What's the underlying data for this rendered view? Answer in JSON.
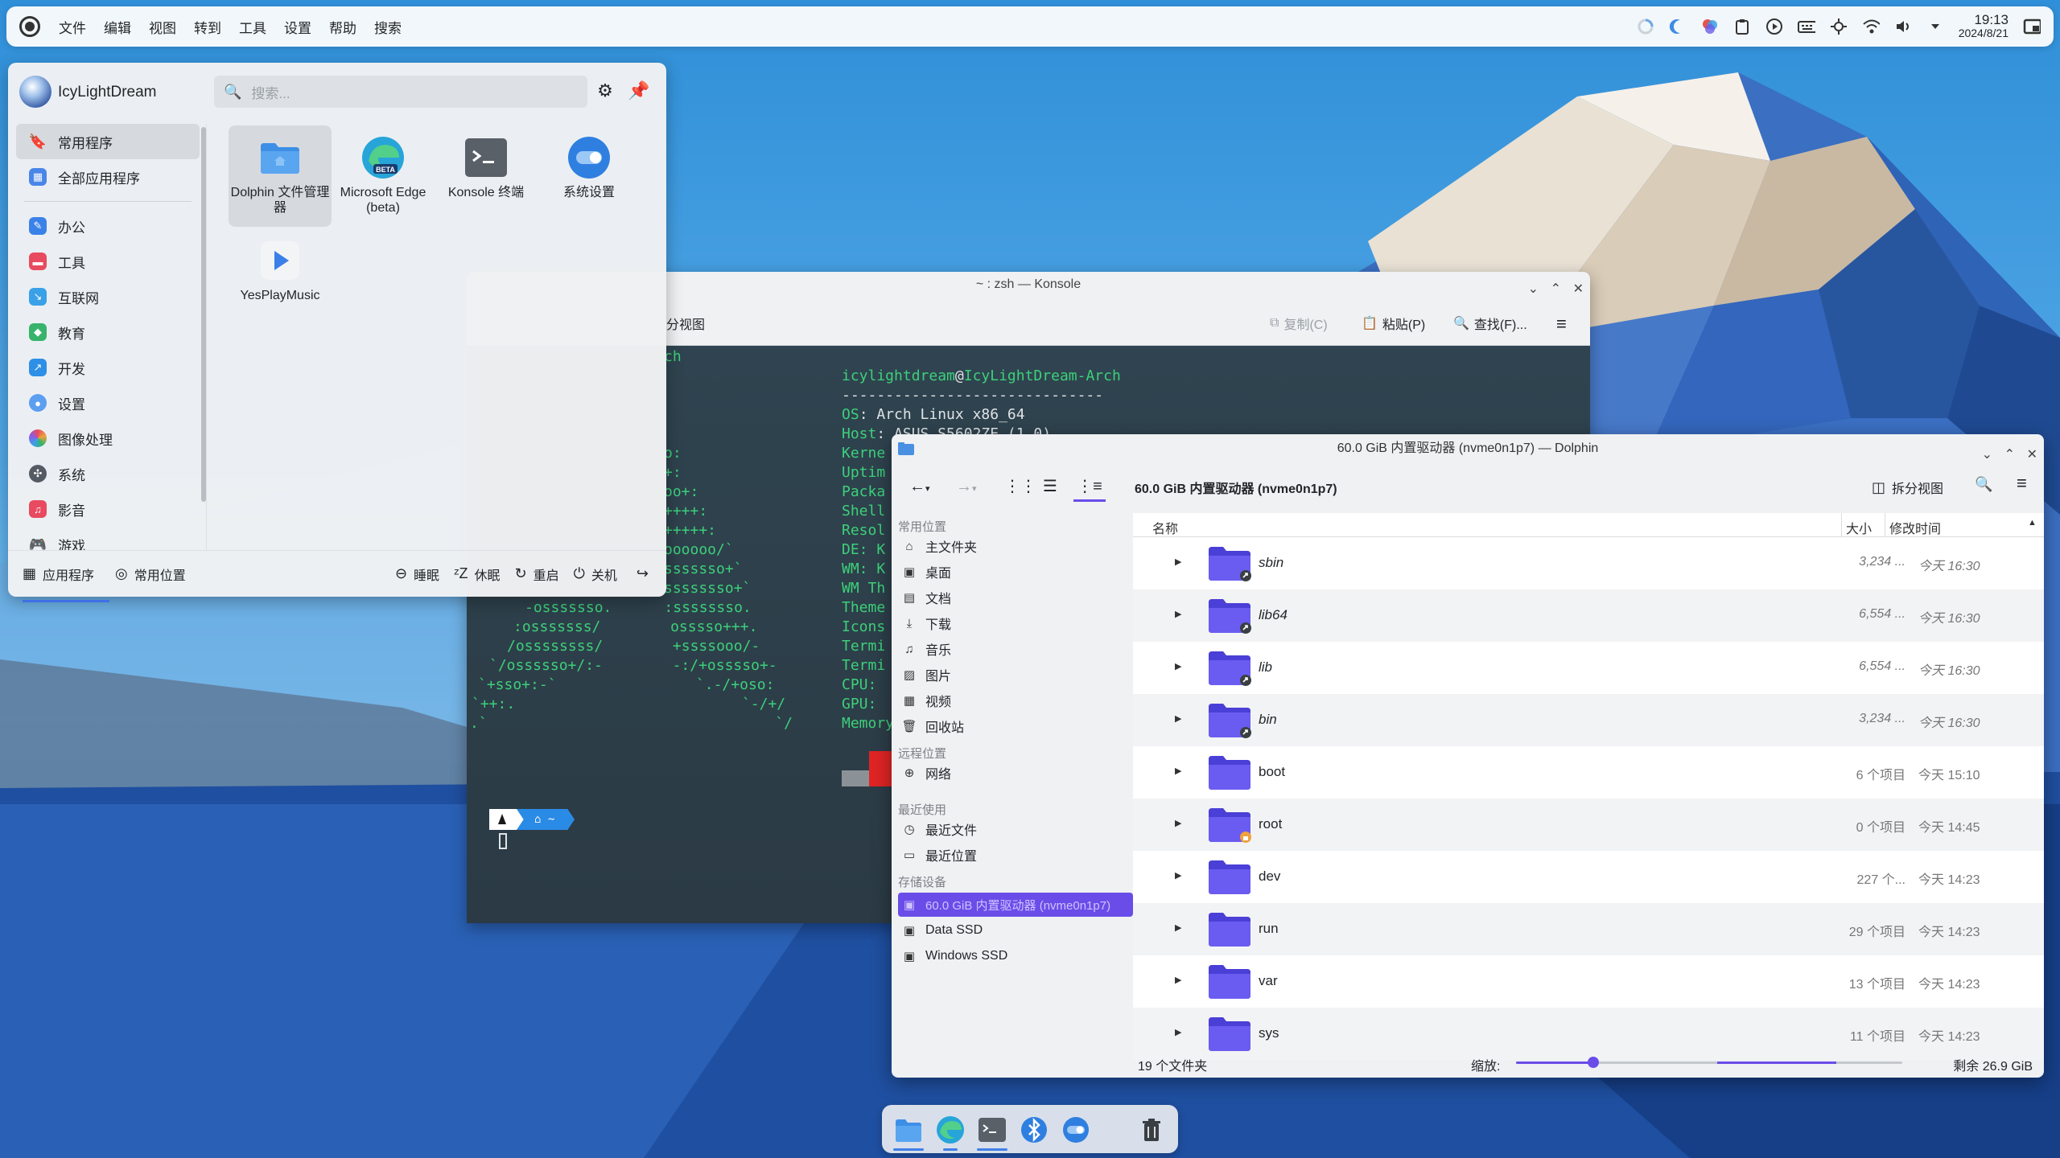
{
  "global_menu": [
    "文件",
    "编辑",
    "视图",
    "转到",
    "工具",
    "设置",
    "帮助",
    "搜索"
  ],
  "clock": {
    "time": "19:13",
    "date": "2024/8/21"
  },
  "tray_icons": [
    "loading-icon",
    "night-mode-icon",
    "color-picker-icon",
    "clipboard-icon",
    "media-play-icon",
    "keyboard-icon",
    "brightness-icon",
    "wifi-icon",
    "volume-icon",
    "expand-tray-icon",
    "show-desktop-icon"
  ],
  "app_menu": {
    "user": "IcyLightDream",
    "search_placeholder": "搜索...",
    "categories": [
      {
        "label": "常用程序",
        "icon": "bookmark-icon",
        "active": true
      },
      {
        "label": "全部应用程序",
        "icon": "grid-icon"
      },
      {
        "label": "办公",
        "icon": "office-icon",
        "color": "#3b82e8"
      },
      {
        "label": "工具",
        "icon": "tools-icon",
        "color": "#e84a5f"
      },
      {
        "label": "互联网",
        "icon": "internet-icon",
        "color": "#3aa0e8"
      },
      {
        "label": "教育",
        "icon": "education-icon",
        "color": "#37b36b"
      },
      {
        "label": "开发",
        "icon": "development-icon",
        "color": "#2d8fe6"
      },
      {
        "label": "设置",
        "icon": "settings-icon",
        "color": "#5c9ef0"
      },
      {
        "label": "图像处理",
        "icon": "graphics-icon",
        "color": "#f0a23c"
      },
      {
        "label": "系统",
        "icon": "system-icon",
        "color": "#555b63"
      },
      {
        "label": "影音",
        "icon": "multimedia-icon",
        "color": "#e84a5f"
      },
      {
        "label": "游戏",
        "icon": "games-icon",
        "color": "#333333"
      }
    ],
    "apps": [
      {
        "name": "Dolphin 文件管理器",
        "icon": "dolphin-icon",
        "active": true
      },
      {
        "name": "Microsoft Edge (beta)",
        "icon": "edge-beta-icon",
        "badge": "BETA"
      },
      {
        "name": "Konsole 终端",
        "icon": "konsole-icon"
      },
      {
        "name": "系统设置",
        "icon": "system-settings-icon"
      },
      {
        "name": "YesPlayMusic",
        "icon": "yesplaymusic-icon"
      }
    ],
    "bottom_left": [
      {
        "label": "应用程序",
        "icon": "apps-icon"
      },
      {
        "label": "常用位置",
        "icon": "places-icon"
      }
    ],
    "bottom_right": [
      {
        "label": "睡眠",
        "icon": "sleep-icon"
      },
      {
        "label": "休眠",
        "icon": "hibernate-icon"
      },
      {
        "label": "重启",
        "icon": "restart-icon"
      },
      {
        "label": "关机",
        "icon": "shutdown-icon"
      }
    ]
  },
  "konsole": {
    "title": "~ : zsh — Konsole",
    "toolbar": {
      "split": "分视图",
      "copy": "复制(C)",
      "paste": "粘贴(P)",
      "find": "查找(F)..."
    },
    "fetch_user": "icylightdream",
    "fetch_at": "@",
    "fetch_host": "IcyLightDream-Arch",
    "fetch_sep": "------------------------------",
    "fetch_os_key": "OS",
    "fetch_os_val": ": Arch Linux x86_64",
    "fetch_host_key": "Host",
    "fetch_host_val": ": ASUS S5602ZE (1.0)",
    "fetch_keys": [
      "Kerne",
      "Uptim",
      "Packa",
      "Shell",
      "Resol",
      "DE: K",
      "WM: K",
      "WM Th",
      "Theme",
      "Icons",
      "Termi",
      "Termi",
      "CPU: ",
      "GPU: ",
      "Memory"
    ],
    "logo_lines": [
      "ch",
      "o:",
      "+:",
      "oo+:",
      "++++:",
      "+++++:",
      "oooooo/`",
      "sssssso+`",
      "ssssssso+`",
      "-osssssso.      :ssssssso.",
      ":osssssss/        osssso+++.",
      "/ossssssss/        +ssssooo/-",
      "`/ossssso+/:-        -:/+osssso+-",
      "`+sso+:-`                `.-/+oso:",
      "`++:.                          `-/+/",
      ".`                                 `/"
    ],
    "prompt_icons": [
      "arch-logo-icon",
      "home-icon"
    ],
    "prompt_path": "~"
  },
  "dolphin": {
    "title": "60.0 GiB 内置驱动器 (nvme0n1p7) — Dolphin",
    "breadcrumb": "60.0 GiB 内置驱动器 (nvme0n1p7)",
    "split_view": "拆分视图",
    "places": {
      "h_common": "常用位置",
      "common": [
        {
          "label": "主文件夹",
          "icon": "home-icon"
        },
        {
          "label": "桌面",
          "icon": "desktop-icon"
        },
        {
          "label": "文档",
          "icon": "documents-icon"
        },
        {
          "label": "下载",
          "icon": "download-icon"
        },
        {
          "label": "音乐",
          "icon": "music-icon"
        },
        {
          "label": "图片",
          "icon": "pictures-icon"
        },
        {
          "label": "视频",
          "icon": "videos-icon"
        },
        {
          "label": "回收站",
          "icon": "trash-icon"
        }
      ],
      "h_remote": "远程位置",
      "remote": [
        {
          "label": "网络",
          "icon": "network-icon"
        }
      ],
      "h_recent": "最近使用",
      "recent": [
        {
          "label": "最近文件",
          "icon": "recent-files-icon"
        },
        {
          "label": "最近位置",
          "icon": "recent-locations-icon"
        }
      ],
      "h_devices": "存储设备",
      "devices": [
        {
          "label": "60.0 GiB 内置驱动器 (nvme0n1p7)",
          "icon": "drive-icon",
          "selected": true
        },
        {
          "label": "Data SSD",
          "icon": "drive-icon"
        },
        {
          "label": "Windows SSD",
          "icon": "drive-icon"
        }
      ]
    },
    "columns": {
      "name": "名称",
      "size": "大小",
      "modified": "修改时间"
    },
    "files": [
      {
        "name": "sbin",
        "size": "3,234 ...",
        "modified": "今天 16:30",
        "link": true
      },
      {
        "name": "lib64",
        "size": "6,554 ...",
        "modified": "今天 16:30",
        "link": true
      },
      {
        "name": "lib",
        "size": "6,554 ...",
        "modified": "今天 16:30",
        "link": true
      },
      {
        "name": "bin",
        "size": "3,234 ...",
        "modified": "今天 16:30",
        "link": true
      },
      {
        "name": "boot",
        "size": "6 个项目",
        "modified": "今天 15:10"
      },
      {
        "name": "root",
        "size": "0 个项目",
        "modified": "今天 14:45",
        "locked": true
      },
      {
        "name": "dev",
        "size": "227 个...",
        "modified": "今天 14:23"
      },
      {
        "name": "run",
        "size": "29 个项目",
        "modified": "今天 14:23"
      },
      {
        "name": "var",
        "size": "13 个项目",
        "modified": "今天 14:23"
      },
      {
        "name": "sys",
        "size": "11 个项目",
        "modified": "今天 14:23"
      }
    ],
    "status": {
      "count": "19 个文件夹",
      "zoom_label": "缩放:",
      "zoom_level": 0.2,
      "free": "剩余 26.9 GiB"
    }
  },
  "dock": [
    {
      "icon": "dolphin-icon",
      "running": true
    },
    {
      "icon": "edge-beta-icon",
      "running": true
    },
    {
      "icon": "konsole-icon",
      "running": true
    },
    {
      "icon": "bluetooth-icon",
      "running": false
    },
    {
      "icon": "system-settings-icon",
      "running": false
    },
    {
      "icon": "trash-icon",
      "running": false
    }
  ]
}
